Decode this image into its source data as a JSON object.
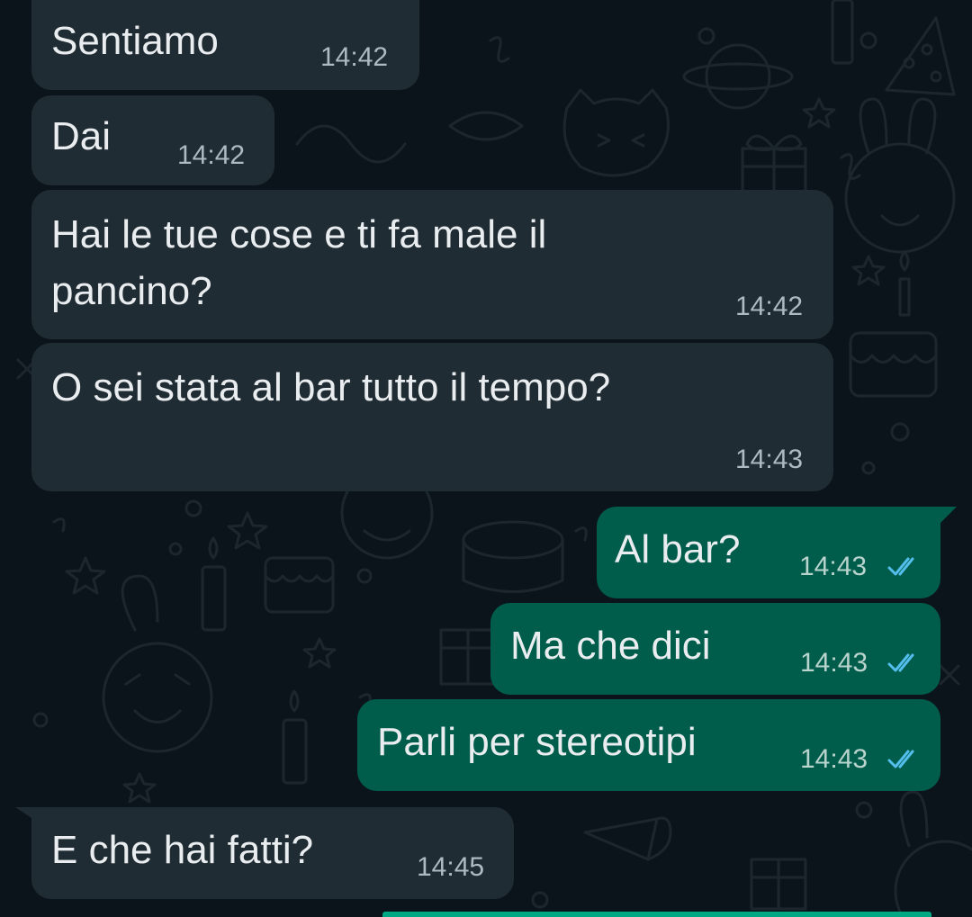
{
  "messages": [
    {
      "direction": "incoming",
      "text": "Sentiamo",
      "time": "14:42"
    },
    {
      "direction": "incoming",
      "text": "Dai",
      "time": "14:42"
    },
    {
      "direction": "incoming",
      "text_line1": "Hai le tue cose e ti fa male il",
      "text_line2": "pancino?",
      "time": "14:42"
    },
    {
      "direction": "incoming",
      "text": "O sei stata al bar tutto il tempo?",
      "time": "14:43"
    },
    {
      "direction": "outgoing",
      "text": "Al bar?",
      "time": "14:43",
      "status_icon": "double-check-read-icon"
    },
    {
      "direction": "outgoing",
      "text": "Ma che dici",
      "time": "14:43",
      "status_icon": "double-check-read-icon"
    },
    {
      "direction": "outgoing",
      "text": "Parli per stereotipi",
      "time": "14:43",
      "status_icon": "double-check-read-icon"
    },
    {
      "direction": "incoming",
      "text": "E che hai fatti?",
      "time": "14:45"
    }
  ],
  "colors": {
    "background": "#0b141a",
    "incoming_bubble": "#202c33",
    "outgoing_bubble": "#005c4b",
    "read_ticks": "#53bdeb",
    "text": "#e9edef"
  }
}
